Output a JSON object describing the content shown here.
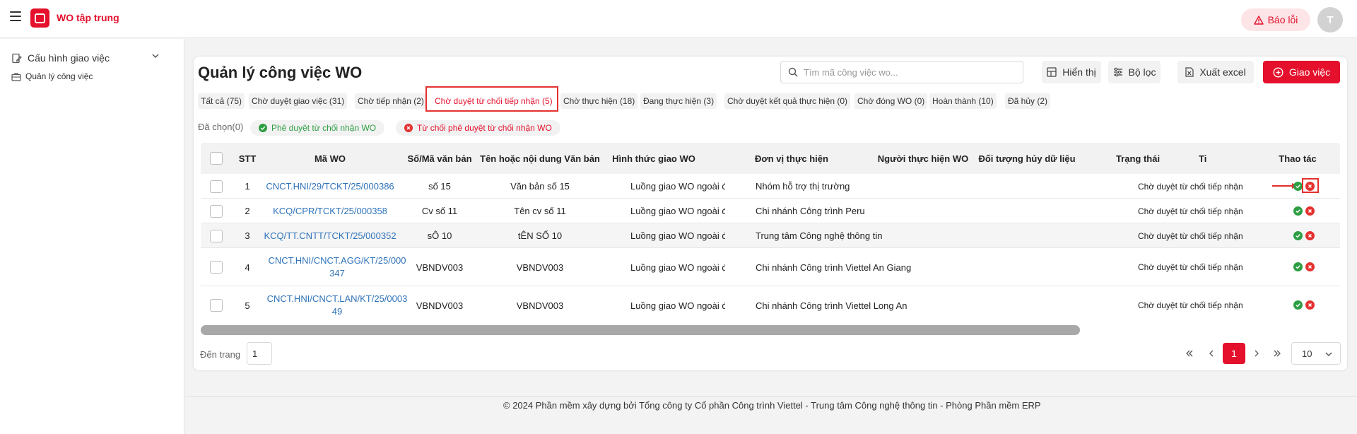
{
  "header": {
    "app_title": "WO tập trung",
    "report_label": "Báo lỗi",
    "avatar_initial": "T"
  },
  "sidebar": {
    "group_label": "Cấu hình giao việc",
    "item_label": "Quản lý công việc"
  },
  "main": {
    "title": "Quản lý công việc WO",
    "search_placeholder": "Tìm mã công việc wo...",
    "display_label": "Hiển thị",
    "filter_label": "Bộ lọc",
    "export_label": "Xuất excel",
    "assign_label": "Giao việc",
    "tabs": [
      {
        "label": "Tất cả (75)"
      },
      {
        "label": "Chờ duyệt giao việc (31)"
      },
      {
        "label": "Chờ tiếp nhận (2)"
      },
      {
        "label": "Chờ duyệt từ chối tiếp nhận (5)"
      },
      {
        "label": "Chờ thực hiện (18)"
      },
      {
        "label": "Đang thực hiện (3)"
      },
      {
        "label": "Chờ duyệt kết quả thực hiện (0)"
      },
      {
        "label": "Chờ đóng WO (0)"
      },
      {
        "label": "Hoàn thành (10)"
      },
      {
        "label": "Đã hủy (2)"
      }
    ],
    "active_tab_index": 3,
    "selected_label": "Đã chọn(0)",
    "approve_chip": "Phê duyệt từ chối nhận WO",
    "reject_chip": "Từ chối phê duyệt từ chối nhận WO"
  },
  "table": {
    "columns": [
      "STT",
      "Mã WO",
      "Số/Mã văn bản",
      "Tên hoặc nội dung Văn bản",
      "Hình thức giao WO",
      "Đơn vị thực hiện",
      "Người thực hiện WO",
      "Đối tượng hủy dữ liệu",
      "Trạng thái",
      "Ti",
      "Thao tác"
    ],
    "rows": [
      {
        "stt": "1",
        "code": "CNCT.HNI/29/TCKT/25/000386",
        "doc_no": "số 15",
        "doc_name": "Văn bản số 15",
        "form": "Luồng giao WO ngoài đơn vị",
        "unit": "Nhóm hỗ trợ thị trường",
        "status": "Chờ duyệt từ chối tiếp nhận"
      },
      {
        "stt": "2",
        "code": "KCQ/CPR/TCKT/25/000358",
        "doc_no": "Cv số 11",
        "doc_name": "Tên cv số 11",
        "form": "Luồng giao WO ngoài đơn vị",
        "unit": "Chi nhánh Công trình Peru",
        "status": "Chờ duyệt từ chối tiếp nhận"
      },
      {
        "stt": "3",
        "code": "KCQ/TT.CNTT/TCKT/25/000352",
        "doc_no": "sÔ 10",
        "doc_name": "tÊN SỐ 10",
        "form": "Luồng giao WO ngoài đơn vị",
        "unit": "Trung tâm Công nghệ thông tin",
        "status": "Chờ duyệt từ chối tiếp nhận"
      },
      {
        "stt": "4",
        "code": "CNCT.HNI/CNCT.AGG/KT/25/000347",
        "doc_no": "VBNDV003",
        "doc_name": "VBNDV003",
        "form": "Luồng giao WO ngoài đơn vị",
        "unit": "Chi nhánh Công trình Viettel An Giang",
        "status": "Chờ duyệt từ chối tiếp nhận"
      },
      {
        "stt": "5",
        "code": "CNCT.HNI/CNCT.LAN/KT/25/000349",
        "doc_no": "VBNDV003",
        "doc_name": "VBNDV003",
        "form": "Luồng giao WO ngoài đơn vị",
        "unit": "Chi nhánh Công trình Viettel Long An",
        "status": "Chờ duyệt từ chối tiếp nhận"
      }
    ]
  },
  "pagination": {
    "goto_label": "Đến trang",
    "goto_value": "1",
    "current_page": "1",
    "page_size": "10"
  },
  "footer": {
    "text": "© 2024 Phần mềm xây dựng bởi Tổng công ty Cổ phần Công trình Viettel - Trung tâm Công nghệ thông tin - Phòng Phần mềm ERP"
  },
  "colors": {
    "brand": "#e4102c",
    "link": "#2f73b9",
    "approve": "#2e9e43"
  }
}
